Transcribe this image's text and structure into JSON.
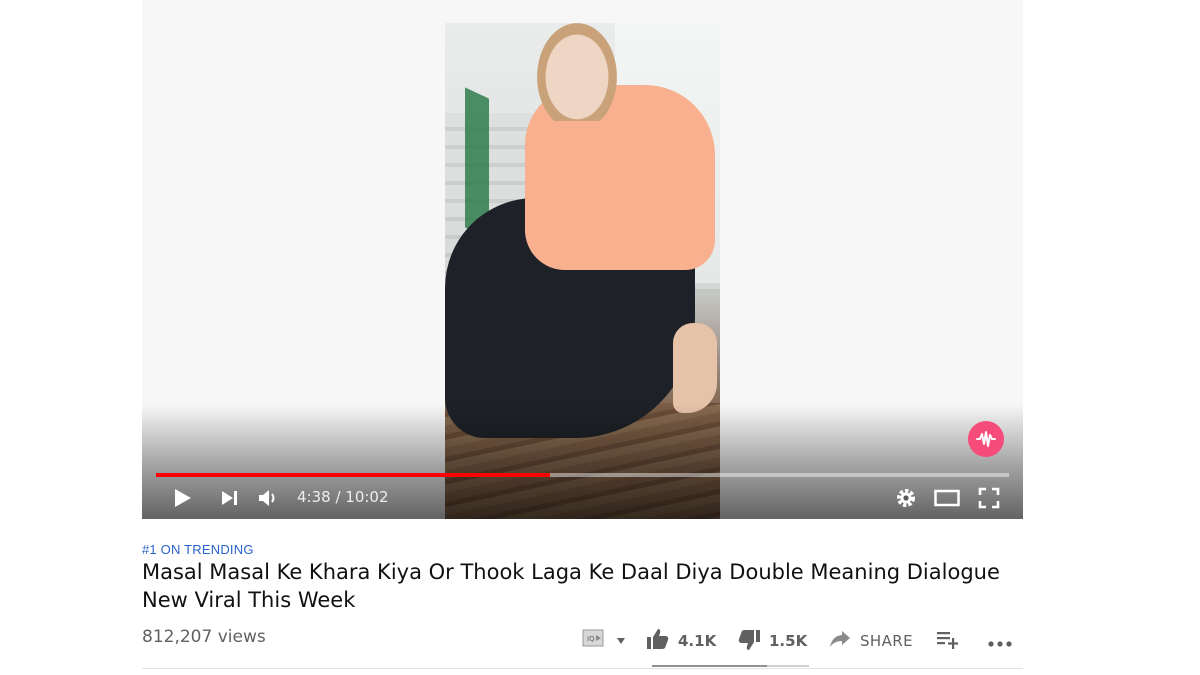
{
  "player": {
    "current_time": "4:38",
    "separator": " / ",
    "duration": "10:02",
    "progress_fraction": 0.462,
    "buttons": [
      "play-icon",
      "next-icon",
      "volume-icon",
      "settings-icon",
      "theater-mode-icon",
      "fullscreen-icon"
    ],
    "watermark_badge": "musically-logo-icon",
    "colors": {
      "progress": "#ff0000",
      "badge": "#f64c7a"
    }
  },
  "video": {
    "trending_label": "#1 ON TRENDING",
    "title": "Masal Masal Ke Khara Kiya Or Thook Laga Ke Daal Diya Double Meaning Dialogue New Viral This Week",
    "views": "812,207 views"
  },
  "actions": {
    "likes": "4.1K",
    "dislikes": "1.5K",
    "share_label": "SHARE",
    "like_fraction": 0.73,
    "icons": [
      "transcript-icon",
      "dropdown-arrow-icon",
      "thumbs-up-icon",
      "thumbs-down-icon",
      "share-arrow-icon",
      "add-to-playlist-icon",
      "more-options-icon"
    ]
  },
  "colors": {
    "trending": "#2a63c9",
    "title": "#111111",
    "meta": "#606060"
  }
}
